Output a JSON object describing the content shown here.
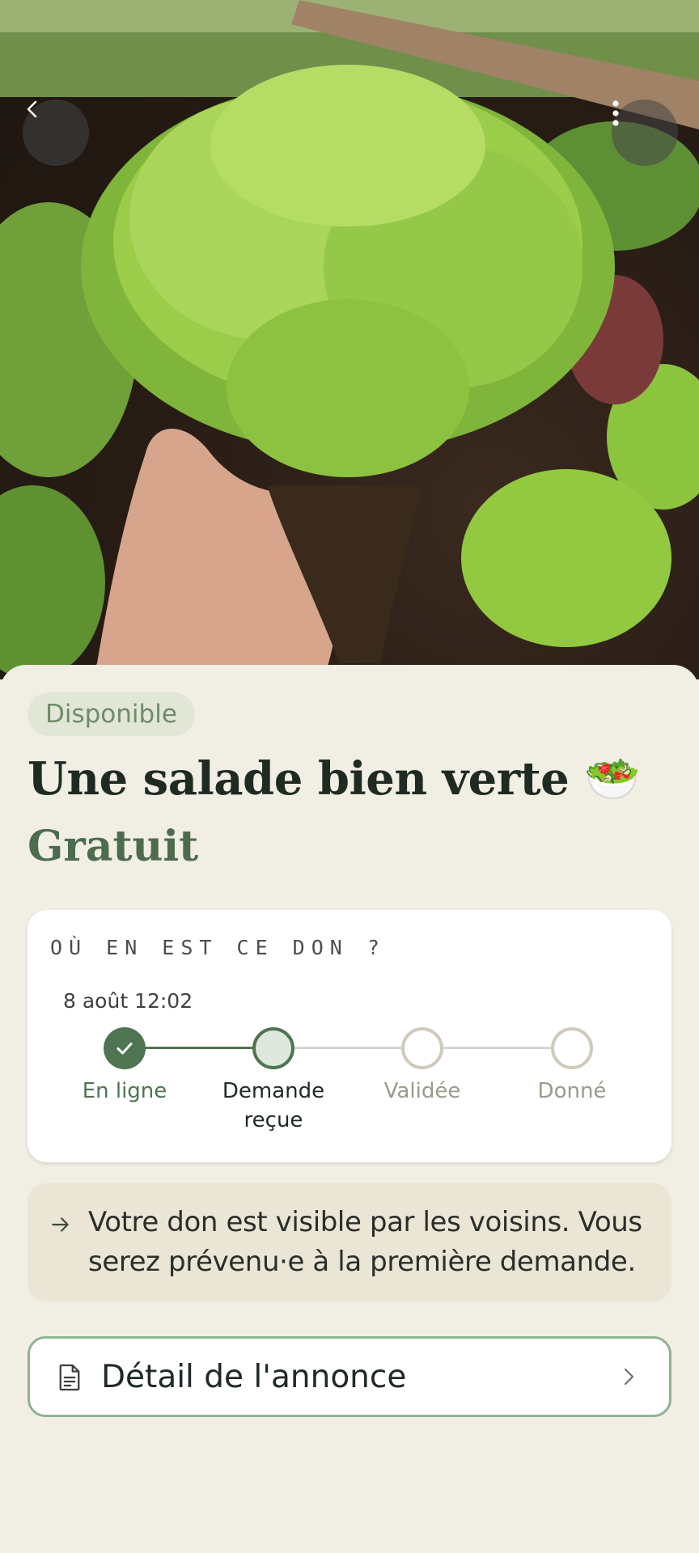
{
  "status_badge": "Disponible",
  "title": "Une salade bien verte 🥗",
  "price": "Gratuit",
  "progress": {
    "heading": "OÙ EN EST CE DON ?",
    "date": "8 août 12:02",
    "steps": [
      {
        "label": "En ligne",
        "state": "complete"
      },
      {
        "label": "Demande reçue",
        "state": "current"
      },
      {
        "label": "Validée",
        "state": "pending"
      },
      {
        "label": "Donné",
        "state": "pending"
      }
    ]
  },
  "info": {
    "icon": "arrow-right-icon",
    "text": "Votre don est visible par les voisins. Vous serez prévenu·e à la première demande."
  },
  "detail_button": {
    "icon": "document-icon",
    "label": "Détail de l'annonce"
  },
  "colors": {
    "accent": "#4f7452",
    "background": "#f1eee4",
    "badge_bg": "#e1e6d6"
  },
  "icons": {
    "back": "chevron-left-icon",
    "more": "more-vertical-icon"
  }
}
